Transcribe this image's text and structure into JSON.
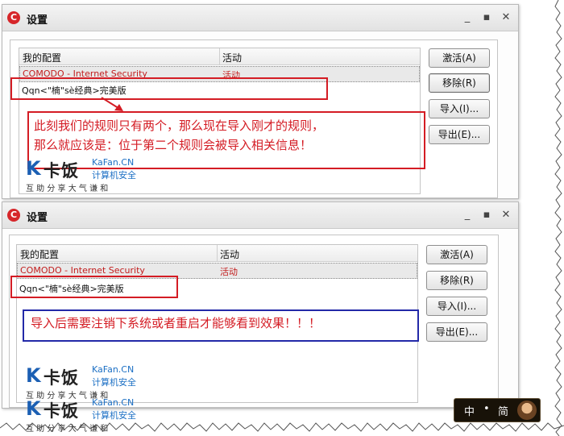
{
  "window": {
    "title": "设置",
    "controls": {
      "minimize": "_",
      "maximize": "▪",
      "close": "✕"
    }
  },
  "list": {
    "header_config": "我的配置",
    "header_active": "活动",
    "rows": [
      {
        "name": "COMODO - Internet Security",
        "status": "活动"
      },
      {
        "name": "Qqn<\"楠\"sè经典>完美版",
        "status": ""
      }
    ]
  },
  "buttons": {
    "activate": "激活(A)",
    "remove": "移除(R)",
    "import": "导入(I)...",
    "export": "导出(E)..."
  },
  "annotations": {
    "top_line1": "此刻我们的规则只有两个，那么现在导入刚才的规则，",
    "top_line2": "那么就应该是：位于第二个规则会被导入相关信息！",
    "bottom": "导入后需要注销下系统或者重启才能够看到效果！！！"
  },
  "watermark": {
    "k": "K",
    "cn": "卡饭",
    "en": "KaFan.CN",
    "sub": "计算机安全",
    "motto": "互 助 分 享    大 气 谦 和"
  },
  "ime": {
    "lang": "中",
    "dot": "•",
    "mode": "简"
  },
  "colors": {
    "annotation_red": "#d41c24",
    "annotation_blue": "#2329a8",
    "logo_blue": "#1b5fb3"
  }
}
